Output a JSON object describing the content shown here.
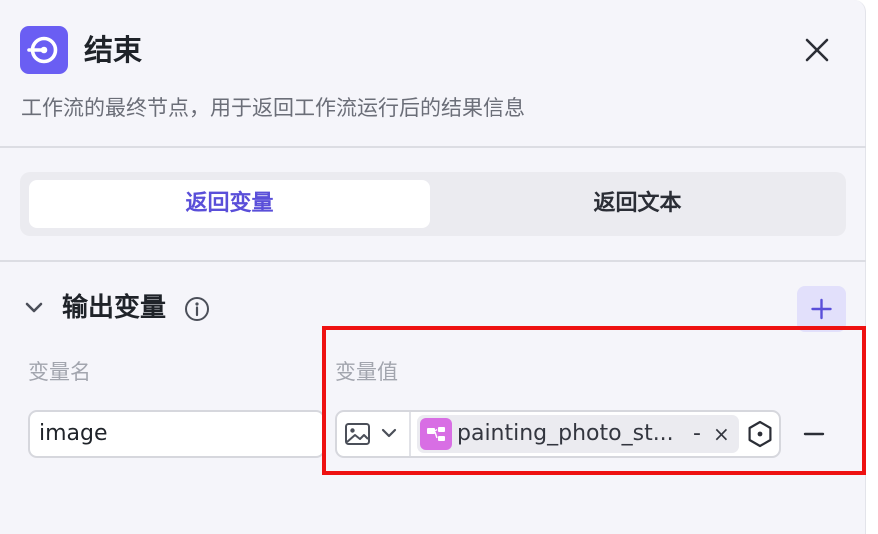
{
  "header": {
    "icon": "end-node-icon",
    "title": "结束",
    "close_icon": "close-icon",
    "description": "工作流的最终节点，用于返回工作流运行后的结果信息"
  },
  "tabs": [
    {
      "label": "返回变量",
      "active": true
    },
    {
      "label": "返回文本",
      "active": false
    }
  ],
  "output": {
    "section_title": "输出变量",
    "info_icon": "info-icon",
    "add_icon": "plus-icon",
    "columns": {
      "name": "变量名",
      "value": "变量值"
    },
    "row": {
      "name": "image",
      "type_icon": "image-icon",
      "variable": "painting_photo_st...",
      "variable_suffix": "-",
      "remove_chip": "×",
      "settings_icon": "hexagon-icon",
      "remove_row_icon": "minus-icon"
    }
  },
  "colors": {
    "accent": "#6a5ef3",
    "accent_text": "#5a4fd9",
    "chip_icon": "#d86ee4",
    "highlight": "#ee1111"
  }
}
